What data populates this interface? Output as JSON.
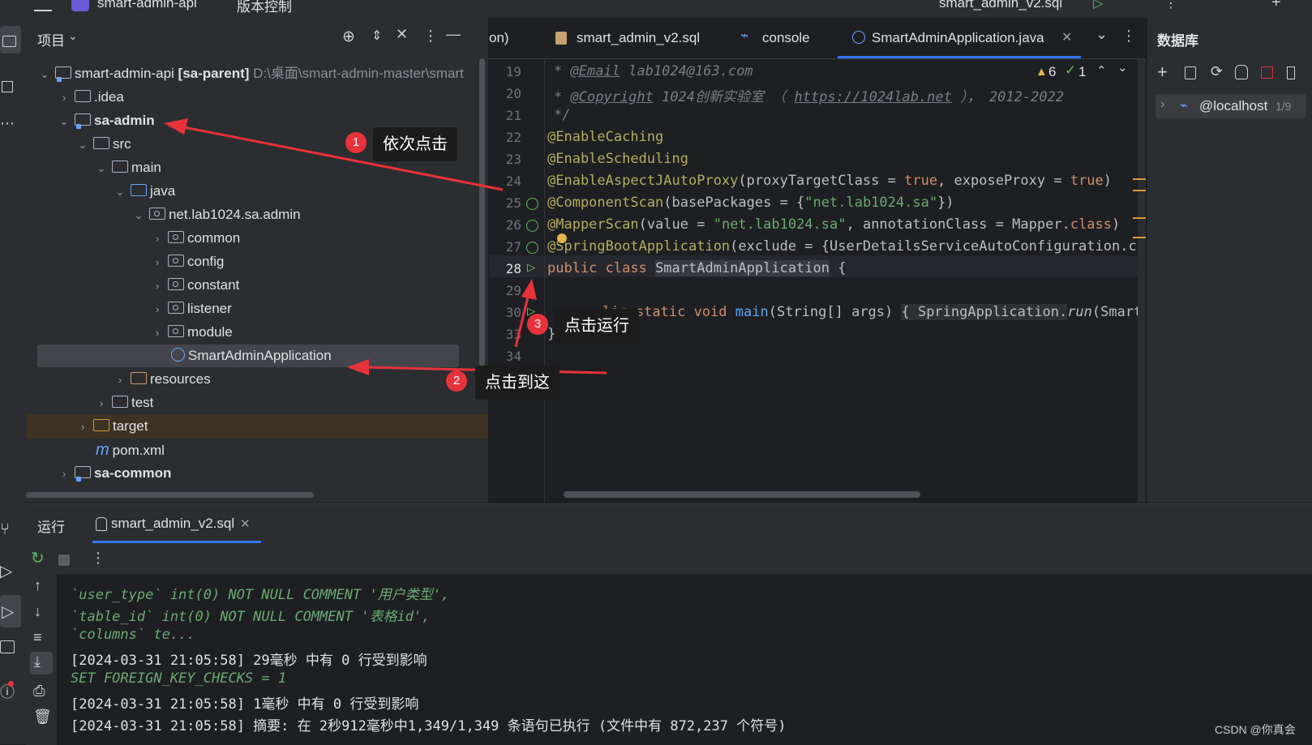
{
  "top_bar": {
    "project_name": "smart-admin-api",
    "menu_label": "版本控制",
    "run_config": "smart_admin_v2.sql"
  },
  "project_panel": {
    "title": "项目",
    "tree": [
      {
        "label": "smart-admin-api",
        "suffix": "[sa-parent]",
        "path": "D:\\桌面\\smart-admin-master\\smart"
      },
      {
        "label": ".idea"
      },
      {
        "label": "sa-admin"
      },
      {
        "label": "src"
      },
      {
        "label": "main"
      },
      {
        "label": "java"
      },
      {
        "label": "net.lab1024.sa.admin"
      },
      {
        "label": "common"
      },
      {
        "label": "config"
      },
      {
        "label": "constant"
      },
      {
        "label": "listener"
      },
      {
        "label": "module"
      },
      {
        "label": "SmartAdminApplication"
      },
      {
        "label": "resources"
      },
      {
        "label": "test"
      },
      {
        "label": "target"
      },
      {
        "label": "pom.xml"
      },
      {
        "label": "sa-common"
      }
    ]
  },
  "editor": {
    "tabs": [
      {
        "label": "on)"
      },
      {
        "label": "smart_admin_v2.sql"
      },
      {
        "label": "console"
      },
      {
        "label": "SmartAdminApplication.java"
      }
    ],
    "warnings": "6",
    "checks": "1",
    "line_numbers": [
      "19",
      "20",
      "21",
      "22",
      "23",
      "24",
      "25",
      "26",
      "27",
      "28",
      "29",
      "30",
      "33",
      "34"
    ],
    "code": {
      "l19_tag": "@Email",
      "l19_rest": " lab1024@163.com",
      "l20_tag": "@Copyright",
      "l20_text": " 1024创新实验室 （ ",
      "l20_link": "https://1024lab.net",
      "l20_tail": " ）， 2012-2022",
      "l21": " */",
      "l22": "@EnableCaching",
      "l23": "@EnableScheduling",
      "l24_ann": "@EnableAspectJAutoProxy",
      "l24_a": "(proxyTargetClass = ",
      "l24_t1": "true",
      "l24_b": ", exposeProxy = ",
      "l24_t2": "true",
      "l24_c": ")",
      "l25_ann": "@ComponentScan",
      "l25_a": "(basePackages = {",
      "l25_s": "\"net.lab1024.sa\"",
      "l25_b": "})",
      "l26_ann": "@MapperScan",
      "l26_a": "(value = ",
      "l26_s": "\"net.lab1024.sa\"",
      "l26_b": ", annotationClass = Mapper.",
      "l26_kw": "class",
      "l26_c": ")",
      "l27_ann": "@SpringBootApplication",
      "l27_a": "(exclude = {UserDetailsServiceAutoConfiguration.cl",
      "l28_kw": "public class ",
      "l28_cls": "SmartAdminApplication",
      "l28_b": " {",
      "l30_kw": "lic static void ",
      "l30_fn": "main",
      "l30_a": "(String[] args) ",
      "l30_b": "{ SpringApplication.",
      "l30_run": "run",
      "l30_c": "(Smart",
      "l33": "}"
    }
  },
  "db_panel": {
    "title": "数据库",
    "host": "@localhost",
    "count": "1/9"
  },
  "run_panel": {
    "title": "运行",
    "tab": "smart_admin_v2.sql",
    "lines": [
      {
        "kind": "sql",
        "text": "`user_type` int(0) NOT NULL COMMENT '用户类型',"
      },
      {
        "kind": "sql",
        "text": "`table_id` int(0) NOT NULL COMMENT '表格id',"
      },
      {
        "kind": "sql",
        "text": "`columns` te..."
      },
      {
        "kind": "plain",
        "text": "[2024-03-31 21:05:58] 29毫秒 中有 0 行受到影响"
      },
      {
        "kind": "sql",
        "text": "SET FOREIGN_KEY_CHECKS = 1"
      },
      {
        "kind": "plain",
        "text": "[2024-03-31 21:05:58] 1毫秒 中有 0 行受到影响"
      },
      {
        "kind": "plain",
        "text": "[2024-03-31 21:05:58] 摘要: 在 2秒912毫秒中1,349/1,349 条语句已执行 (文件中有 872,237 个符号)"
      }
    ]
  },
  "callouts": [
    {
      "num": "1",
      "text": "依次点击"
    },
    {
      "num": "2",
      "text": "点击到这"
    },
    {
      "num": "3",
      "text": "点击运行"
    }
  ],
  "watermark": "CSDN @你真会"
}
